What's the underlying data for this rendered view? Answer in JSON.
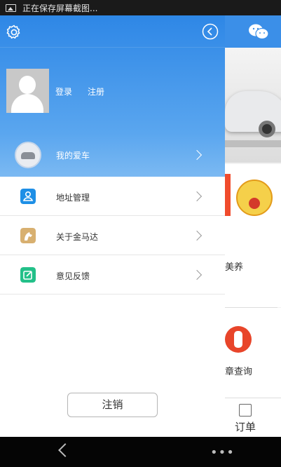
{
  "status_bar": {
    "text": "正在保存屏幕截图..."
  },
  "drawer": {
    "auth": {
      "login": "登录",
      "register": "注册"
    },
    "menu": [
      {
        "label": "我的爱车",
        "icon": "car-icon",
        "active": true
      },
      {
        "label": "地址管理",
        "icon": "address-icon",
        "color": "#1e8fe6"
      },
      {
        "label": "关于金马达",
        "icon": "horse-logo-icon",
        "color": "#d8b070"
      },
      {
        "label": "意见反馈",
        "icon": "feedback-icon",
        "color": "#23c089"
      }
    ],
    "logout_label": "注销"
  },
  "background_page": {
    "service_1_label": "美养",
    "service_2_label": "章查询",
    "tab_label": "订单"
  },
  "colors": {
    "header_blue": "#3b8fe8",
    "active_row": "#5aa6ef"
  }
}
